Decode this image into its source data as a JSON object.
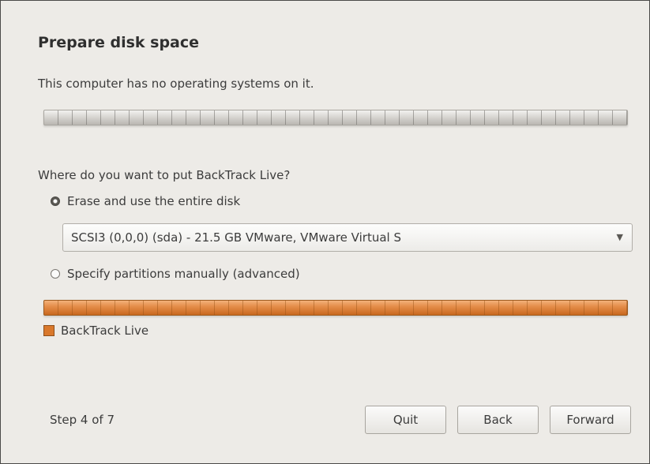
{
  "dialog": {
    "title": "Prepare disk space",
    "intro": "This computer has no operating systems on it.",
    "question": "Where do you want to put BackTrack Live?"
  },
  "options": {
    "erase_label": "Erase and use the entire disk",
    "erase_selected": true,
    "manual_label": "Specify partitions manually (advanced)",
    "manual_selected": false
  },
  "disk_select": {
    "value": "SCSI3 (0,0,0) (sda) - 21.5 GB VMware, VMware Virtual S",
    "arrow": "▼"
  },
  "partition_legend": {
    "label": "BackTrack Live",
    "color": "#d9782c"
  },
  "footer": {
    "step": "Step 4 of 7",
    "quit_label": "Quit",
    "back_label": "Back",
    "forward_label": "Forward"
  }
}
